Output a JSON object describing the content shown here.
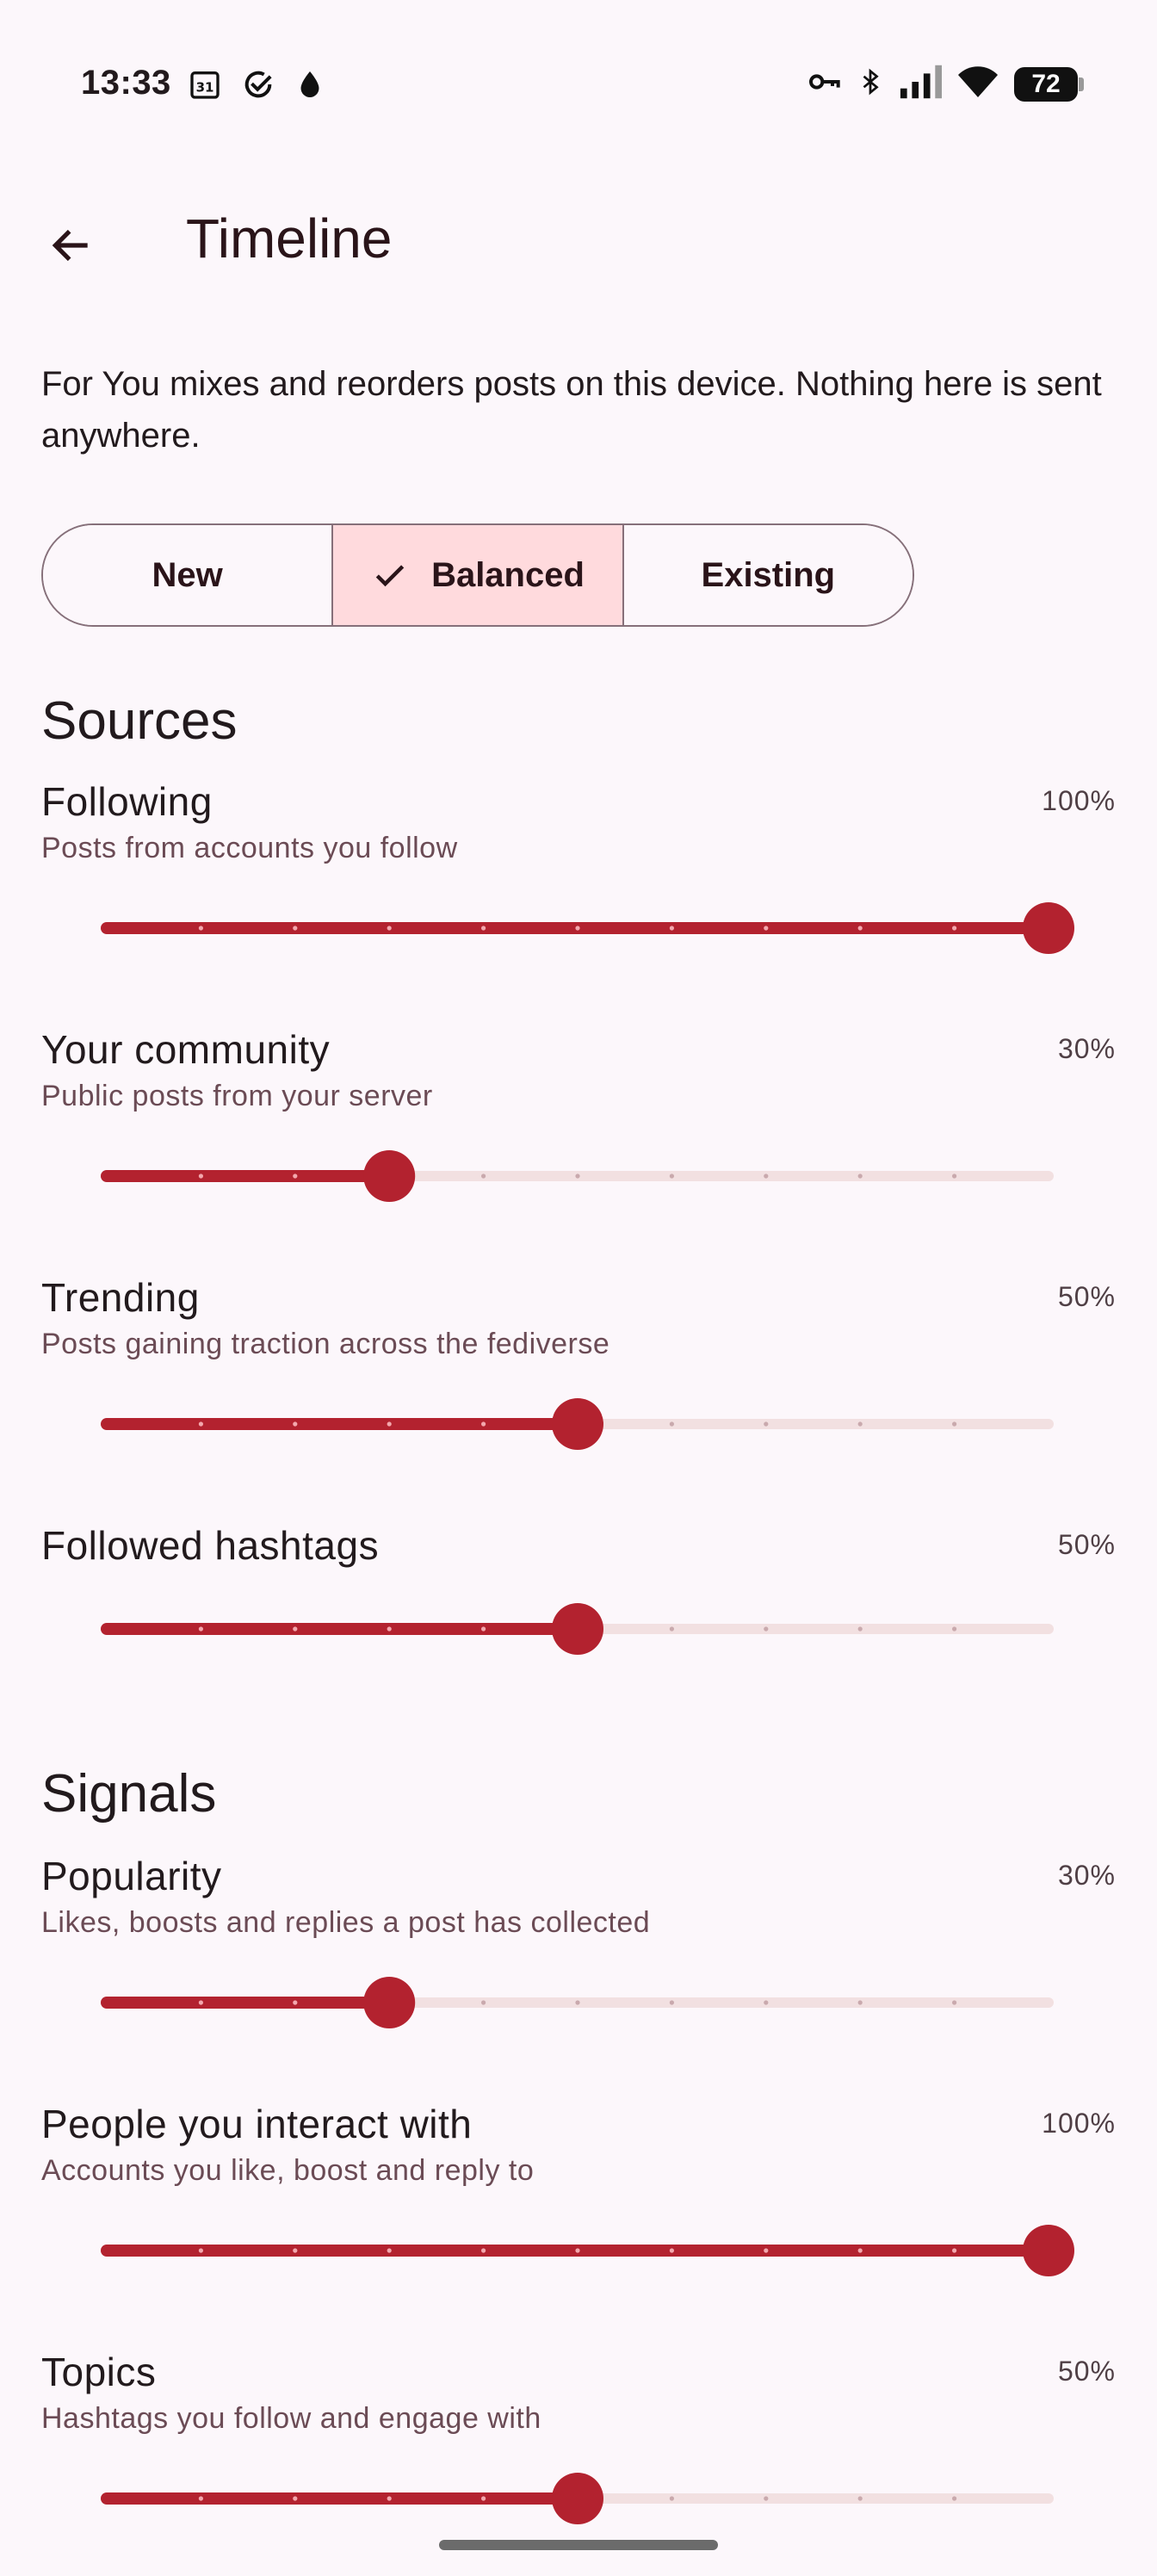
{
  "status_bar": {
    "time": "13:33",
    "battery": "72",
    "left_icons": [
      "calendar-31-icon",
      "check-circle-icon",
      "drop-icon"
    ],
    "right_icons": [
      "vpn-key-icon",
      "bluetooth-icon",
      "cell-signal-icon",
      "wifi-icon",
      "battery-icon"
    ]
  },
  "app_bar": {
    "title": "Timeline",
    "back_icon": "arrow-back-icon"
  },
  "intro": "For You mixes and reorders posts on this device. Nothing here is sent anywhere.",
  "mode_selector": {
    "options": [
      {
        "label": "New",
        "selected": false
      },
      {
        "label": "Balanced",
        "selected": true
      },
      {
        "label": "Existing",
        "selected": false
      }
    ]
  },
  "sections": [
    {
      "title": "Sources",
      "settings": [
        {
          "name": "Following",
          "value": "100%",
          "level": 1.0,
          "description": "Posts from accounts you follow"
        },
        {
          "name": "Your community",
          "value": "30%",
          "level": 0.3,
          "description": "Public posts from your server"
        },
        {
          "name": "Trending",
          "value": "50%",
          "level": 0.5,
          "description": "Posts gaining traction across the fediverse"
        },
        {
          "name": "Followed hashtags",
          "value": "50%",
          "level": 0.5,
          "description": ""
        }
      ]
    },
    {
      "title": "Signals",
      "settings": [
        {
          "name": "Popularity",
          "value": "30%",
          "level": 0.3,
          "description": "Likes, boosts and replies a post has collected"
        },
        {
          "name": "People you interact with",
          "value": "100%",
          "level": 1.0,
          "description": "Accounts you like, boost and reply to"
        },
        {
          "name": "Topics",
          "value": "50%",
          "level": 0.5,
          "description": "Hashtags you follow and engage with"
        }
      ]
    }
  ],
  "colors": {
    "accent": "#b3222f",
    "track_inactive": "#f2e0e1",
    "selected_segment": "#ffdadd",
    "background": "#fcf7fb"
  }
}
